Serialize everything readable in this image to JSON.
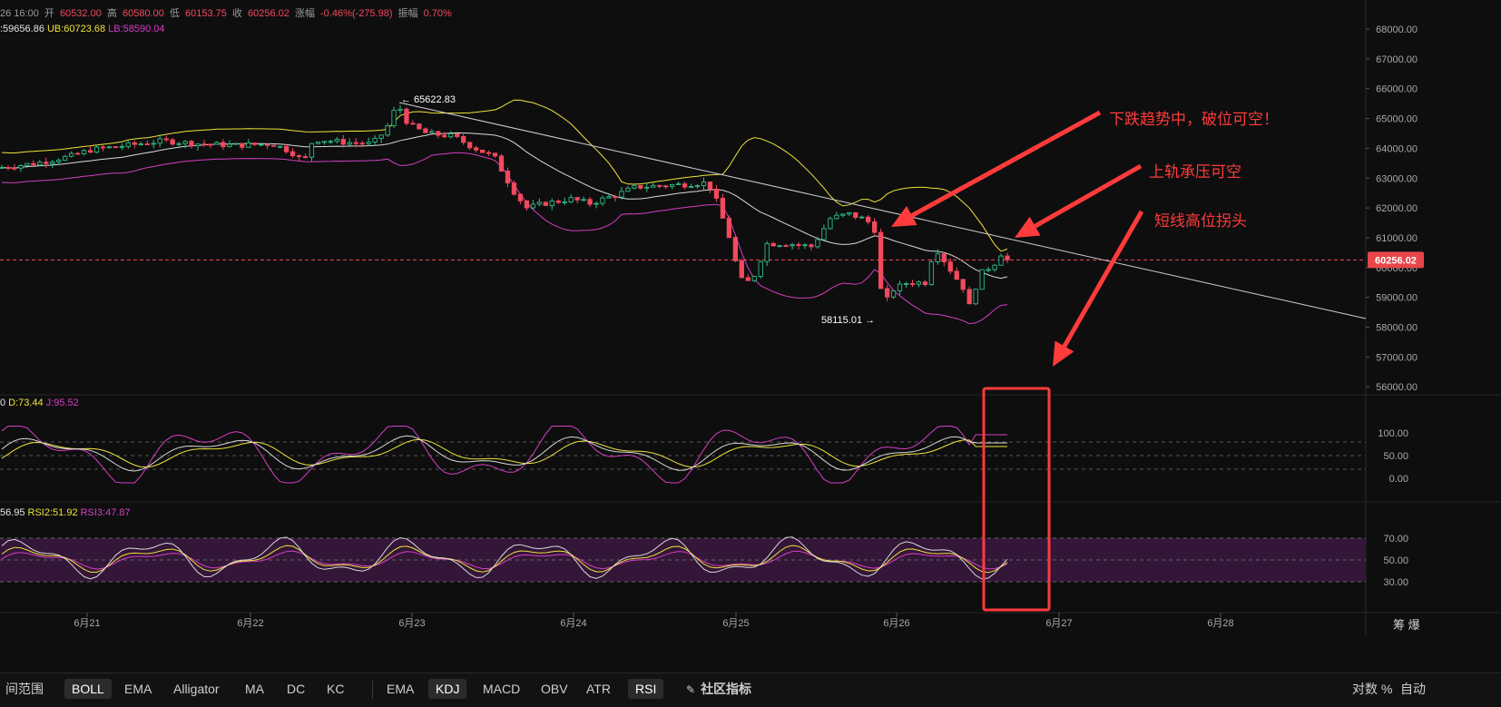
{
  "header": {
    "ohlc_line": [
      {
        "text": "26 16:00",
        "color": "#9a9a9a"
      },
      {
        "text": " 开 ",
        "color": "#9a9a9a"
      },
      {
        "text": "60532.00",
        "color": "#f2495c"
      },
      {
        "text": " 高 ",
        "color": "#9a9a9a"
      },
      {
        "text": "60580.00",
        "color": "#f2495c"
      },
      {
        "text": " 低 ",
        "color": "#9a9a9a"
      },
      {
        "text": "60153.75",
        "color": "#f2495c"
      },
      {
        "text": " 收 ",
        "color": "#9a9a9a"
      },
      {
        "text": "60256.02",
        "color": "#f2495c"
      },
      {
        "text": " 涨幅 ",
        "color": "#9a9a9a"
      },
      {
        "text": "-0.46%(-275.98)",
        "color": "#f2495c"
      },
      {
        "text": " 振幅 ",
        "color": "#9a9a9a"
      },
      {
        "text": "0.70%",
        "color": "#f2495c"
      }
    ],
    "boll_line": [
      {
        "text": ":59656.86",
        "color": "#e6e6e6"
      },
      {
        "text": "UB:60723.68",
        "color": "#f0e33a"
      },
      {
        "text": "LB:58590.04",
        "color": "#d63fc4"
      }
    ],
    "kdj_line": [
      {
        "text": "0",
        "color": "#e6e6e6"
      },
      {
        "text": "D:73.44",
        "color": "#f0e33a"
      },
      {
        "text": "J:95.52",
        "color": "#d63fc4"
      }
    ],
    "rsi_line": [
      {
        "text": "56.95",
        "color": "#e6e6e6"
      },
      {
        "text": "RSI2:51.92",
        "color": "#f0e33a"
      },
      {
        "text": "RSI3:47.87",
        "color": "#d63fc4"
      }
    ]
  },
  "chart_data": [
    {
      "type": "candlestick",
      "title": "",
      "price_axis_ticks": [
        "68000.00",
        "67000.00",
        "66000.00",
        "65000.00",
        "64000.00",
        "63000.00",
        "62000.00",
        "61000.00",
        "60000.00",
        "59000.00",
        "58000.00",
        "57000.00",
        "56000.00"
      ],
      "ylim": [
        55600,
        68600
      ],
      "x_ticks": [
        "6月21",
        "6月22",
        "6月23",
        "6月24",
        "6月25",
        "6月26",
        "6月27",
        "6月28"
      ],
      "current_price": "60256.02",
      "high_label": "65622.83",
      "low_label": "58115.01",
      "overlays": [
        "BOLL MID",
        "BOLL UB",
        "BOLL LB"
      ],
      "colors": {
        "up": "#2dbd85",
        "down": "#f2495c",
        "mid": "#d9d9d9",
        "ub": "#f0e33a",
        "lb": "#d63fc4"
      }
    },
    {
      "type": "line",
      "title": "KDJ",
      "axis_ticks": [
        "100.00",
        "50.00",
        "0.00"
      ],
      "ylim": [
        -20,
        120
      ],
      "series": [
        "K",
        "D",
        "J"
      ]
    },
    {
      "type": "line",
      "title": "RSI",
      "axis_ticks": [
        "70.00",
        "50.00",
        "30.00"
      ],
      "ylim": [
        10,
        90
      ],
      "series": [
        "RSI1",
        "RSI2",
        "RSI3"
      ]
    }
  ],
  "annotations": {
    "text1": "下跌趋势中，破位可空！",
    "text2": "上轨承压可空",
    "text3": "短线高位拐头",
    "color": "#ff3b3b"
  },
  "toolbar": {
    "range_label": "间范围",
    "main_indicators": [
      "BOLL",
      "EMA",
      "Alligator",
      "MA",
      "DC",
      "KC"
    ],
    "sub_indicators": [
      "EMA",
      "KDJ",
      "MACD",
      "OBV",
      "ATR",
      "RSI"
    ],
    "community": "社区指标",
    "right_items": [
      "对数",
      "%",
      "自动"
    ],
    "corner_text": "筹 爆"
  }
}
